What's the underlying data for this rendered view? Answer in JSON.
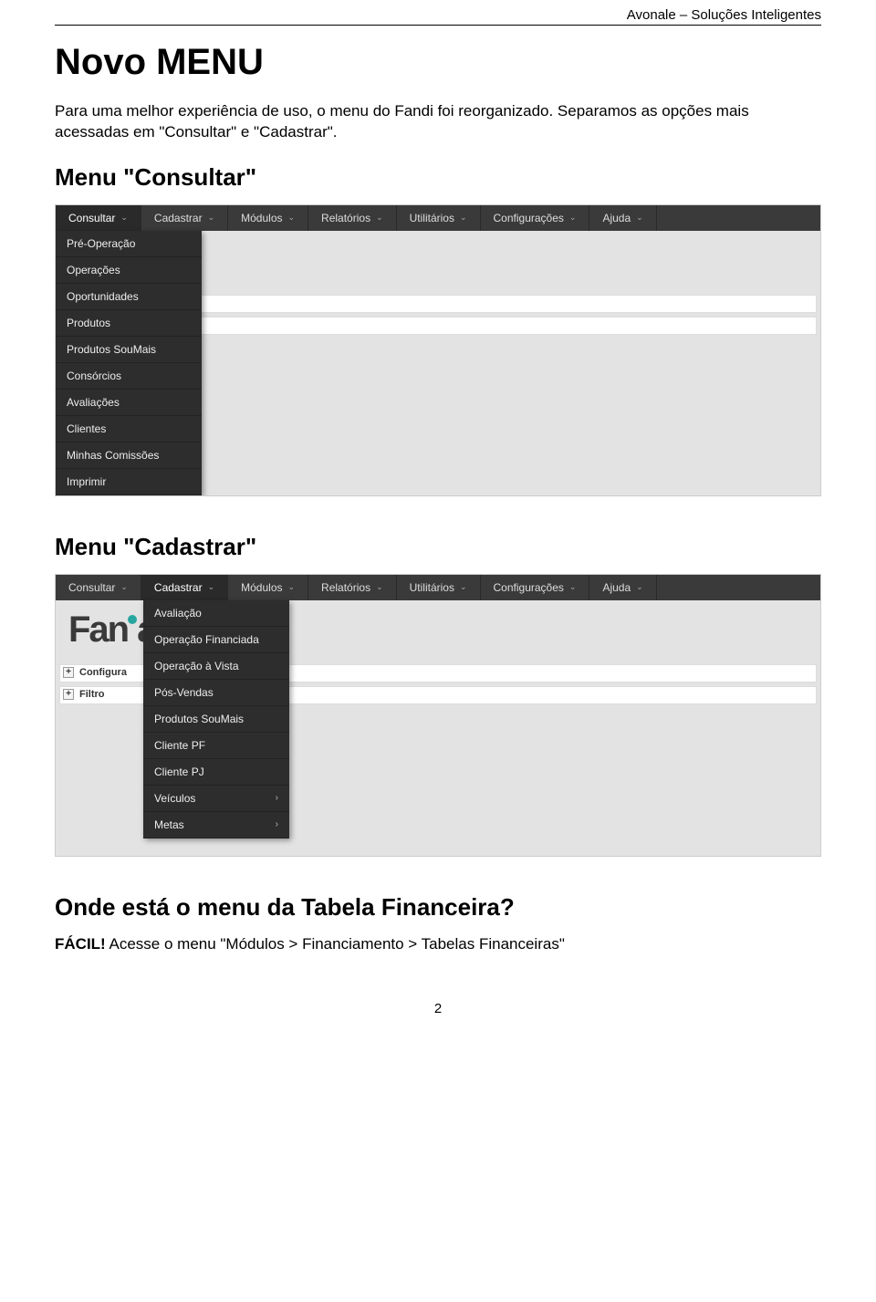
{
  "header": {
    "brand": "Avonale – Soluções Inteligentes"
  },
  "title": "Novo MENU",
  "intro": "Para uma melhor experiência de uso, o menu do Fandi foi reorganizado. Separamos as opções mais acessadas em \"Consultar\" e \"Cadastrar\".",
  "section_consultar_title": "Menu \"Consultar\"",
  "section_cadastrar_title": "Menu \"Cadastrar\"",
  "menubar": {
    "items": [
      {
        "label": "Consultar"
      },
      {
        "label": "Cadastrar"
      },
      {
        "label": "Módulos"
      },
      {
        "label": "Relatórios"
      },
      {
        "label": "Utilitários"
      },
      {
        "label": "Configurações"
      },
      {
        "label": "Ajuda"
      }
    ]
  },
  "consultar_dropdown": [
    "Pré-Operação",
    "Operações",
    "Oportunidades",
    "Produtos",
    "Produtos SouMais",
    "Consórcios",
    "Avaliações",
    "Clientes",
    "Minhas Comissões",
    "Imprimir"
  ],
  "cadastrar_dropdown": [
    {
      "label": "Avaliação",
      "arrow": false
    },
    {
      "label": "Operação Financiada",
      "arrow": false
    },
    {
      "label": "Operação à Vista",
      "arrow": false
    },
    {
      "label": "Pós-Vendas",
      "arrow": false
    },
    {
      "label": "Produtos SouMais",
      "arrow": false
    },
    {
      "label": "Cliente PF",
      "arrow": false
    },
    {
      "label": "Cliente PJ",
      "arrow": false
    },
    {
      "label": "Veículos",
      "arrow": true
    },
    {
      "label": "Metas",
      "arrow": true
    }
  ],
  "behind_segments": {
    "logo_part1": "Fan",
    "logo_part2": "a",
    "configuracoes_partial": "Configura",
    "filtro_partial": "Filtro"
  },
  "question_title": "Onde está o menu da Tabela Financeira?",
  "answer_prefix": "FÁCIL!",
  "answer_rest": " Acesse o menu \"Módulos > Financiamento > Tabelas Financeiras\"",
  "page_number": "2"
}
